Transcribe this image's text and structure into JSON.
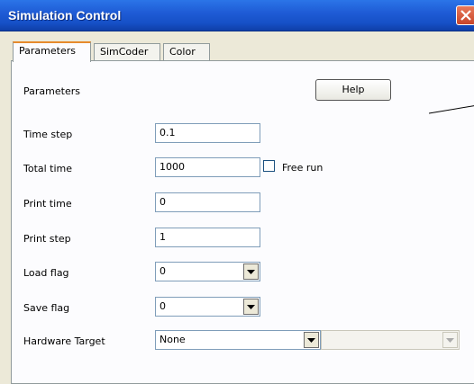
{
  "window": {
    "title": "Simulation Control"
  },
  "tabs": [
    {
      "label": "Parameters",
      "active": true
    },
    {
      "label": "SimCoder",
      "active": false
    },
    {
      "label": "Color",
      "active": false
    }
  ],
  "panel": {
    "heading": "Parameters",
    "help_label": "Help",
    "fields": {
      "time_step": {
        "label": "Time step",
        "value": "0.1"
      },
      "total_time": {
        "label": "Total time",
        "value": "1000"
      },
      "free_run": {
        "label": "Free run",
        "checked": false
      },
      "print_time": {
        "label": "Print time",
        "value": "0"
      },
      "print_step": {
        "label": "Print step",
        "value": "1"
      },
      "load_flag": {
        "label": "Load flag",
        "value": "0"
      },
      "save_flag": {
        "label": "Save flag",
        "value": "0"
      },
      "hardware_target": {
        "label": "Hardware Target",
        "value": "None",
        "secondary_value": ""
      }
    }
  },
  "colors": {
    "title_bar": "#1F5CD6",
    "active_tab_accent": "#E68B2C",
    "close_button": "#D35B3A"
  },
  "icons": {
    "close": "close-icon",
    "dropdown": "triangle-down-icon"
  }
}
